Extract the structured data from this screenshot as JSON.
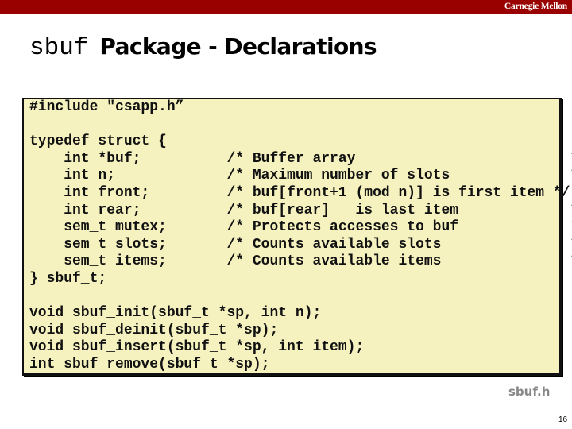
{
  "header": {
    "brand": "Carnegie Mellon",
    "brand_bar_color": "#990000"
  },
  "slide": {
    "title_code": "sbuf",
    "title_text": "Package - Declarations",
    "code_lines": [
      "#include \"csapp.h”",
      "",
      "typedef struct {",
      "    int *buf;          /* Buffer array                         */",
      "    int n;             /* Maximum number of slots              */",
      "    int front;         /* buf[front+1 (mod n)] is first item */",
      "    int rear;          /* buf[rear]   is last item             */",
      "    sem_t mutex;       /* Protects accesses to buf             */",
      "    sem_t slots;       /* Counts available slots               */",
      "    sem_t items;       /* Counts available items               */",
      "} sbuf_t;",
      "",
      "void sbuf_init(sbuf_t *sp, int n);",
      "void sbuf_deinit(sbuf_t *sp);",
      "void sbuf_insert(sbuf_t *sp, int item);",
      "int sbuf_remove(sbuf_t *sp);"
    ],
    "code_background": "#f5f2c0",
    "filename": "sbuf.h",
    "page_number": "16"
  }
}
